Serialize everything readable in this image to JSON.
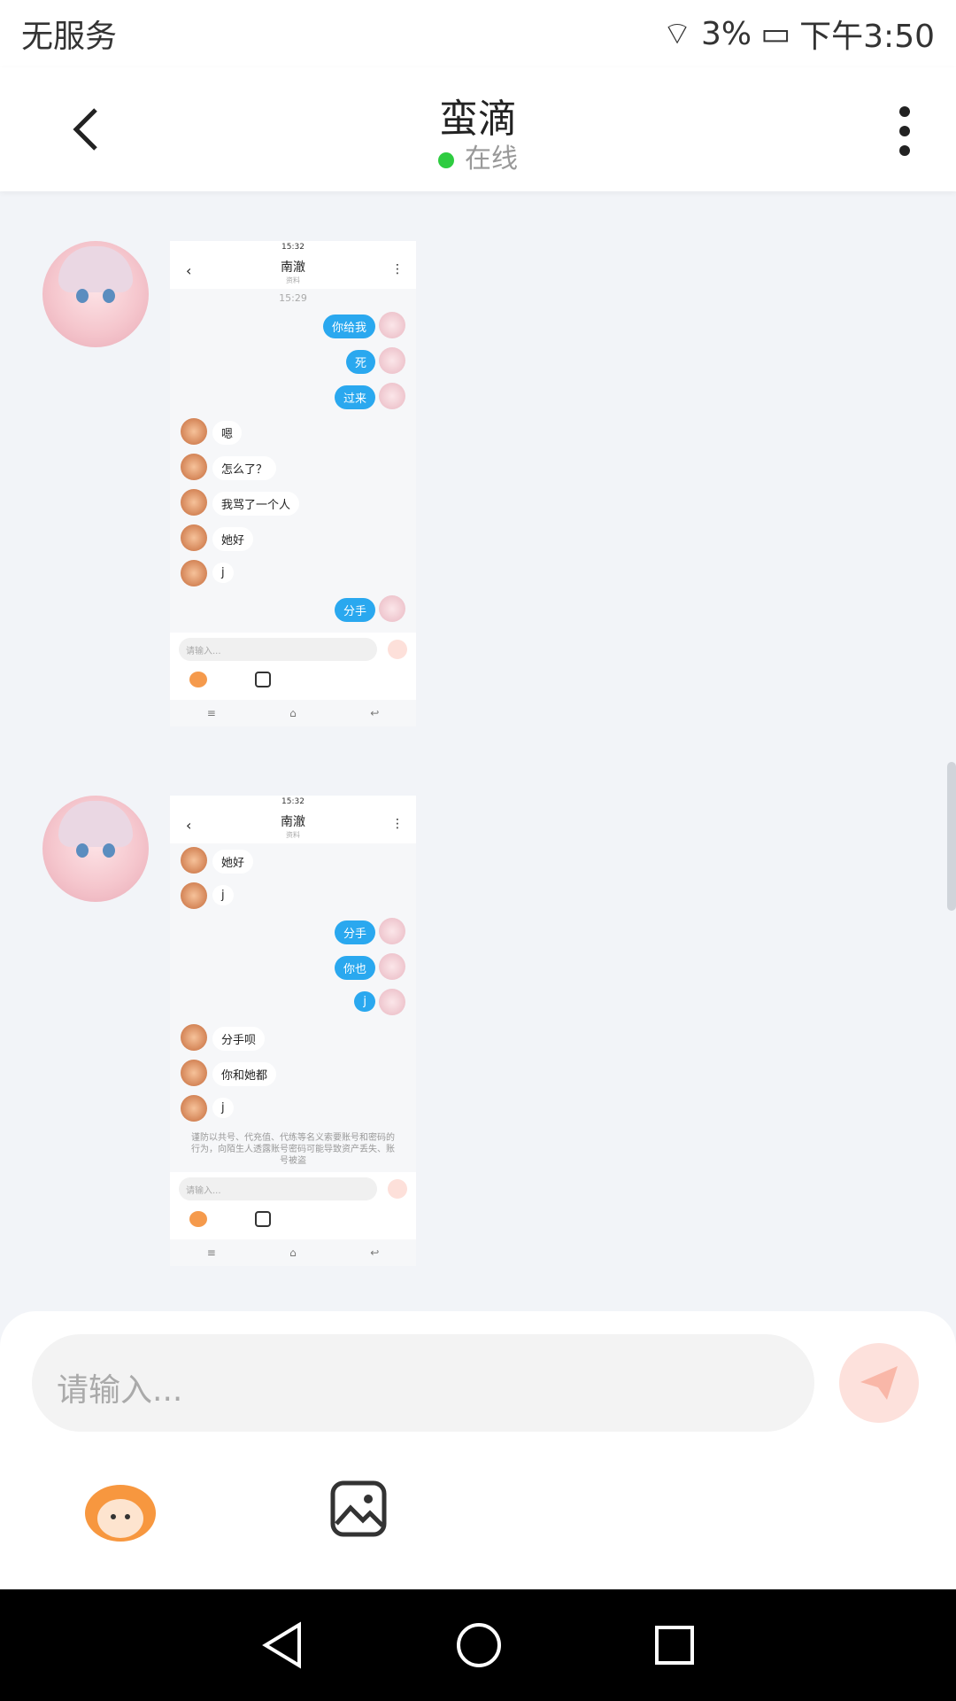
{
  "status": {
    "carrier": "无服务",
    "battery": "3%",
    "time": "下午3:50"
  },
  "header": {
    "title": "蛮滴",
    "status": "在线"
  },
  "composer": {
    "placeholder": "请输入..."
  },
  "screenshot1": {
    "status_time": "15:32",
    "title": "南澈",
    "subtitle": "资料",
    "time": "15:29",
    "messages": [
      {
        "from": "me",
        "text": "你给我"
      },
      {
        "from": "me",
        "text": "死"
      },
      {
        "from": "me",
        "text": "过来"
      },
      {
        "from": "other",
        "text": "嗯"
      },
      {
        "from": "other",
        "text": "怎么了？"
      },
      {
        "from": "other",
        "text": "我骂了一个人"
      },
      {
        "from": "other",
        "text": "她好"
      },
      {
        "from": "other",
        "text": "j"
      },
      {
        "from": "me",
        "text": "分手"
      }
    ],
    "input_placeholder": "请输入..."
  },
  "screenshot2": {
    "status_time": "15:32",
    "title": "南澈",
    "subtitle": "资料",
    "messages": [
      {
        "from": "other",
        "text": "她好"
      },
      {
        "from": "other",
        "text": "j"
      },
      {
        "from": "me",
        "text": "分手"
      },
      {
        "from": "me",
        "text": "你也"
      },
      {
        "from": "me",
        "text": "j"
      },
      {
        "from": "other",
        "text": "分手呗"
      },
      {
        "from": "other",
        "text": "你和她都"
      },
      {
        "from": "other",
        "text": "j"
      }
    ],
    "notice": "谨防以共号、代充值、代练等名义索要账号和密码的行为，向陌生人透露账号密码可能导致资产丢失、账号被盗",
    "input_placeholder": "请输入..."
  },
  "icons": [
    "back-icon",
    "more-icon",
    "send-icon",
    "emoji-icon",
    "image-icon",
    "nav-back-icon",
    "nav-home-icon",
    "nav-recents-icon"
  ]
}
